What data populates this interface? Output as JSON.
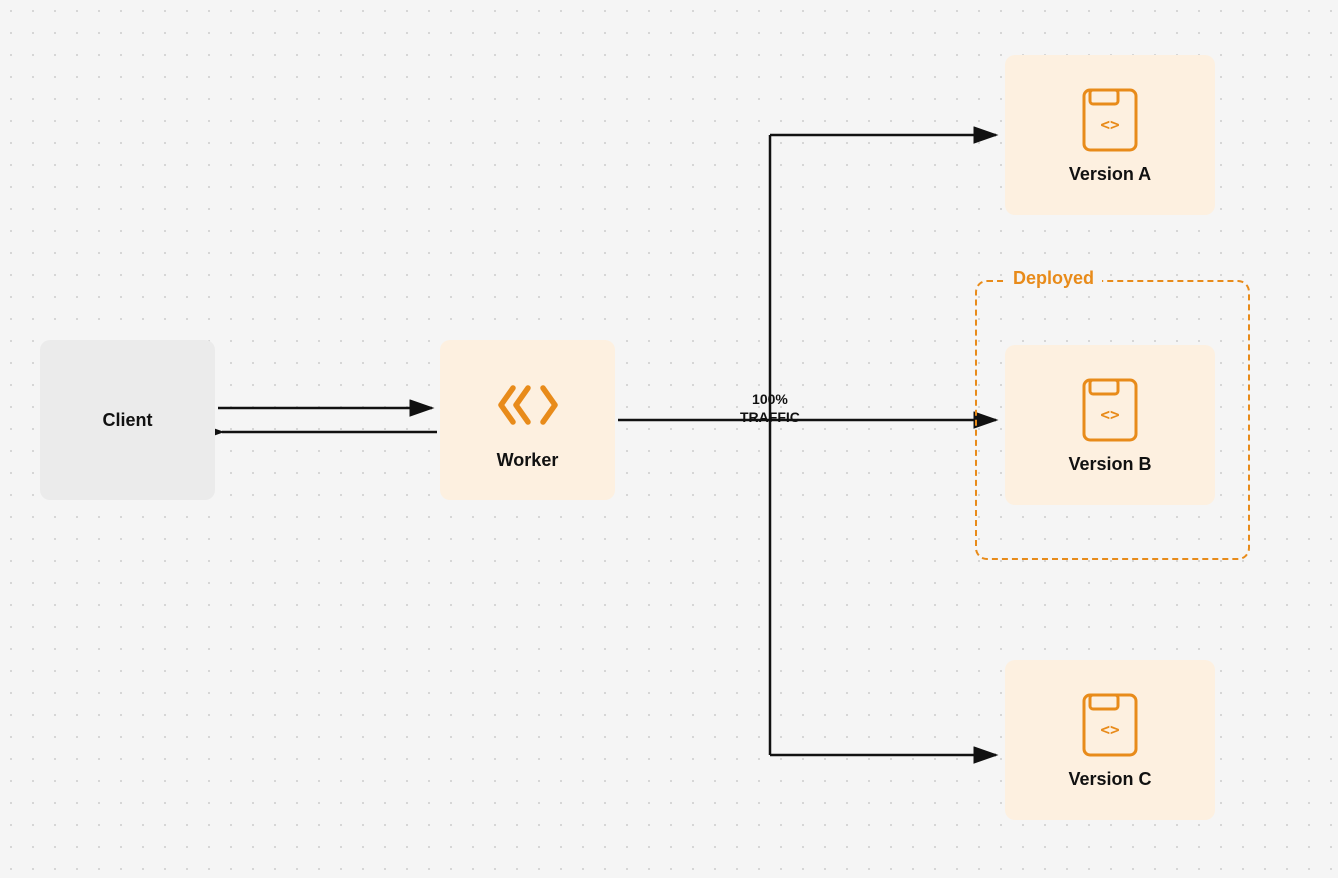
{
  "diagram": {
    "client": {
      "label": "Client"
    },
    "worker": {
      "label": "Worker"
    },
    "version_a": {
      "label": "Version A"
    },
    "version_b": {
      "label": "Version B"
    },
    "version_c": {
      "label": "Version C"
    },
    "deployed_label": "Deployed",
    "traffic_label": "100%\nTRAFFIC",
    "traffic_line1": "100%",
    "traffic_line2": "TRAFFIC"
  },
  "colors": {
    "orange": "#e88b1a",
    "orange_light_bg": "#fdf0e0",
    "client_bg": "#ebebeb",
    "text_dark": "#111111",
    "dashed_border": "#e88b1a"
  }
}
